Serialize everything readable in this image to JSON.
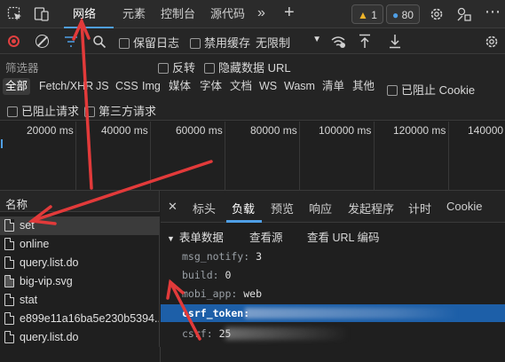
{
  "tabs": {
    "network": "网络",
    "elements": "元素",
    "console": "控制台",
    "sources": "源代码",
    "warnings": "1",
    "messages": "80"
  },
  "toolbar": {
    "preserve_log": "保留日志",
    "disable_cache": "禁用缓存",
    "throttle": "无限制"
  },
  "filter": {
    "placeholder": "筛选器",
    "invert": "反转",
    "hide_data_url": "隐藏数据 URL",
    "blocked_cookies": "已阻止 Cookie",
    "blocked_requests": "已阻止请求",
    "third_party": "第三方请求"
  },
  "types": [
    "全部",
    "Fetch/XHR",
    "JS",
    "CSS",
    "Img",
    "媒体",
    "字体",
    "文档",
    "WS",
    "Wasm",
    "清单",
    "其他"
  ],
  "ticks": [
    "20000 ms",
    "40000 ms",
    "60000 ms",
    "80000 ms",
    "100000 ms",
    "120000 ms",
    "140000"
  ],
  "list": {
    "header": "名称",
    "items": [
      "set",
      "online",
      "query.list.do",
      "big-vip.svg",
      "stat",
      "e899e11a16ba5e230b5394...",
      "query.list.do"
    ]
  },
  "details": {
    "tabs": [
      "标头",
      "负载",
      "预览",
      "响应",
      "发起程序",
      "计时",
      "Cookie"
    ],
    "form_data": "表单数据",
    "view_source": "查看源",
    "view_url_encoded": "查看 URL 编码",
    "fields": [
      {
        "k": "msg_notify:",
        "v": "3"
      },
      {
        "k": "build:",
        "v": "0"
      },
      {
        "k": "mobi_app:",
        "v": "web"
      },
      {
        "k": "csrf_token:",
        "v": ""
      },
      {
        "k": "csrf:",
        "v": "25"
      }
    ]
  },
  "colors": {
    "accent": "#4f9fe6",
    "record": "#e04040",
    "selection": "#1d5fa8",
    "arrow": "#e23a3a"
  }
}
